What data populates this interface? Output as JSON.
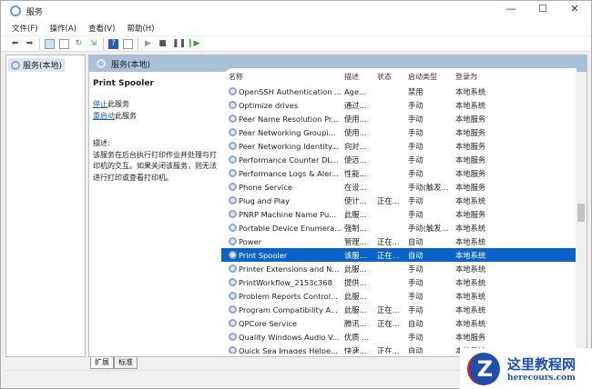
{
  "window": {
    "title": "服务",
    "controls": [
      "—",
      "☐",
      "✕"
    ]
  },
  "menu": [
    "文件(F)",
    "操作(A)",
    "查看(V)",
    "帮助(H)"
  ],
  "tree": {
    "root": "服务(本地)"
  },
  "pane_header": "服务(本地)",
  "detail": {
    "title": "Print Spooler",
    "stop_link": "停止",
    "stop_suffix": "此服务",
    "restart_link": "重启动",
    "restart_suffix": "此服务",
    "desc_label": "描述:",
    "desc": "该服务在后台执行打印作业并处理与打印机的交互。如果关闭该服务，则无法进行打印或查看打印机。"
  },
  "columns": [
    "名称",
    "描述",
    "状态",
    "启动类型",
    "登录为"
  ],
  "rows": [
    [
      "OpenSSH Authentication ...",
      "Age...",
      "",
      "禁用",
      "本地系统"
    ],
    [
      "Optimize drives",
      "通过...",
      "",
      "手动",
      "本地系统"
    ],
    [
      "Peer Name Resolution Pr...",
      "使用...",
      "",
      "手动",
      "本地服务"
    ],
    [
      "Peer Networking Groupi...",
      "使用...",
      "",
      "手动",
      "本地服务"
    ],
    [
      "Peer Networking Identity...",
      "向对...",
      "",
      "手动",
      "本地服务"
    ],
    [
      "Performance Counter DL...",
      "使远...",
      "",
      "手动",
      "本地服务"
    ],
    [
      "Performance Logs & Aler...",
      "性能...",
      "",
      "手动",
      "本地服务"
    ],
    [
      "Phone Service",
      "在设...",
      "",
      "手动(触发...",
      "本地服务"
    ],
    [
      "Plug and Play",
      "使计...",
      "正在...",
      "手动",
      "本地系统"
    ],
    [
      "PNRP Machine Name Pu...",
      "此服...",
      "",
      "手动",
      "本地服务"
    ],
    [
      "Portable Device Enumera...",
      "强制...",
      "",
      "手动(触发...",
      "本地系统"
    ],
    [
      "Power",
      "管理...",
      "正在...",
      "自动",
      "本地系统"
    ],
    [
      "Print Spooler",
      "该服...",
      "正在...",
      "自动",
      "本地系统"
    ],
    [
      "Printer Extensions and N...",
      "此服...",
      "",
      "手动",
      "本地系统"
    ],
    [
      "PrintWorkflow_2153c368",
      "提供...",
      "",
      "手动",
      "本地系统"
    ],
    [
      "Problem Reports Control...",
      "此服...",
      "",
      "手动",
      "本地系统"
    ],
    [
      "Program Compatibility A...",
      "此服...",
      "正在...",
      "手动",
      "本地系统"
    ],
    [
      "QPCore Service",
      "腾讯...",
      "正在...",
      "自动",
      "本地系统"
    ],
    [
      "Quality Windows Audio V...",
      "优质 ...",
      "",
      "手动",
      "本地服务"
    ],
    [
      "Quick Sea Images Helpe...",
      "快速...",
      "正在...",
      "自动",
      "本地系统"
    ]
  ],
  "selected_index": 12,
  "tabs": [
    "扩展",
    "标准"
  ],
  "watermark": {
    "cn": "这里教程网",
    "en": "herecours.com",
    "mark": "Z"
  }
}
